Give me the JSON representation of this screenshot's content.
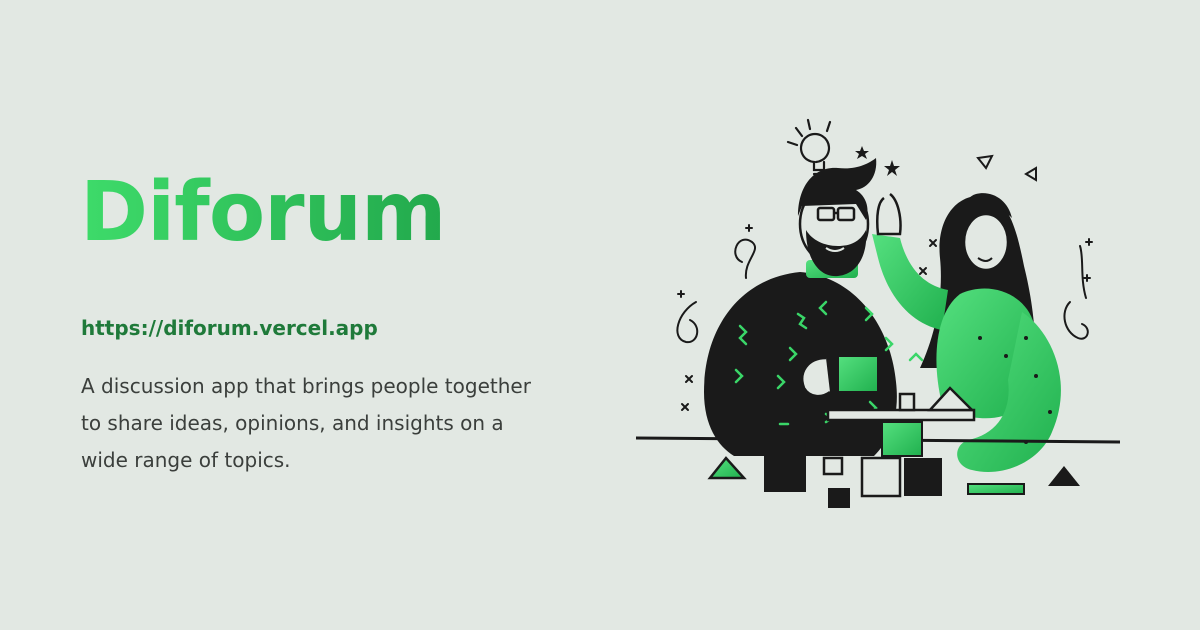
{
  "title": "Diforum",
  "url": "https://diforum.vercel.app",
  "description": "A discussion app that brings people together to share ideas, opinions, and insights on a wide range of topics.",
  "colors": {
    "background": "#e2e8e3",
    "brand_green": "#2fc45a",
    "link_green": "#1f7a3a",
    "text": "#3b3f3c",
    "ink": "#1a1a1a"
  },
  "illustration": {
    "subject": "two-people-collaborating-illustration"
  }
}
